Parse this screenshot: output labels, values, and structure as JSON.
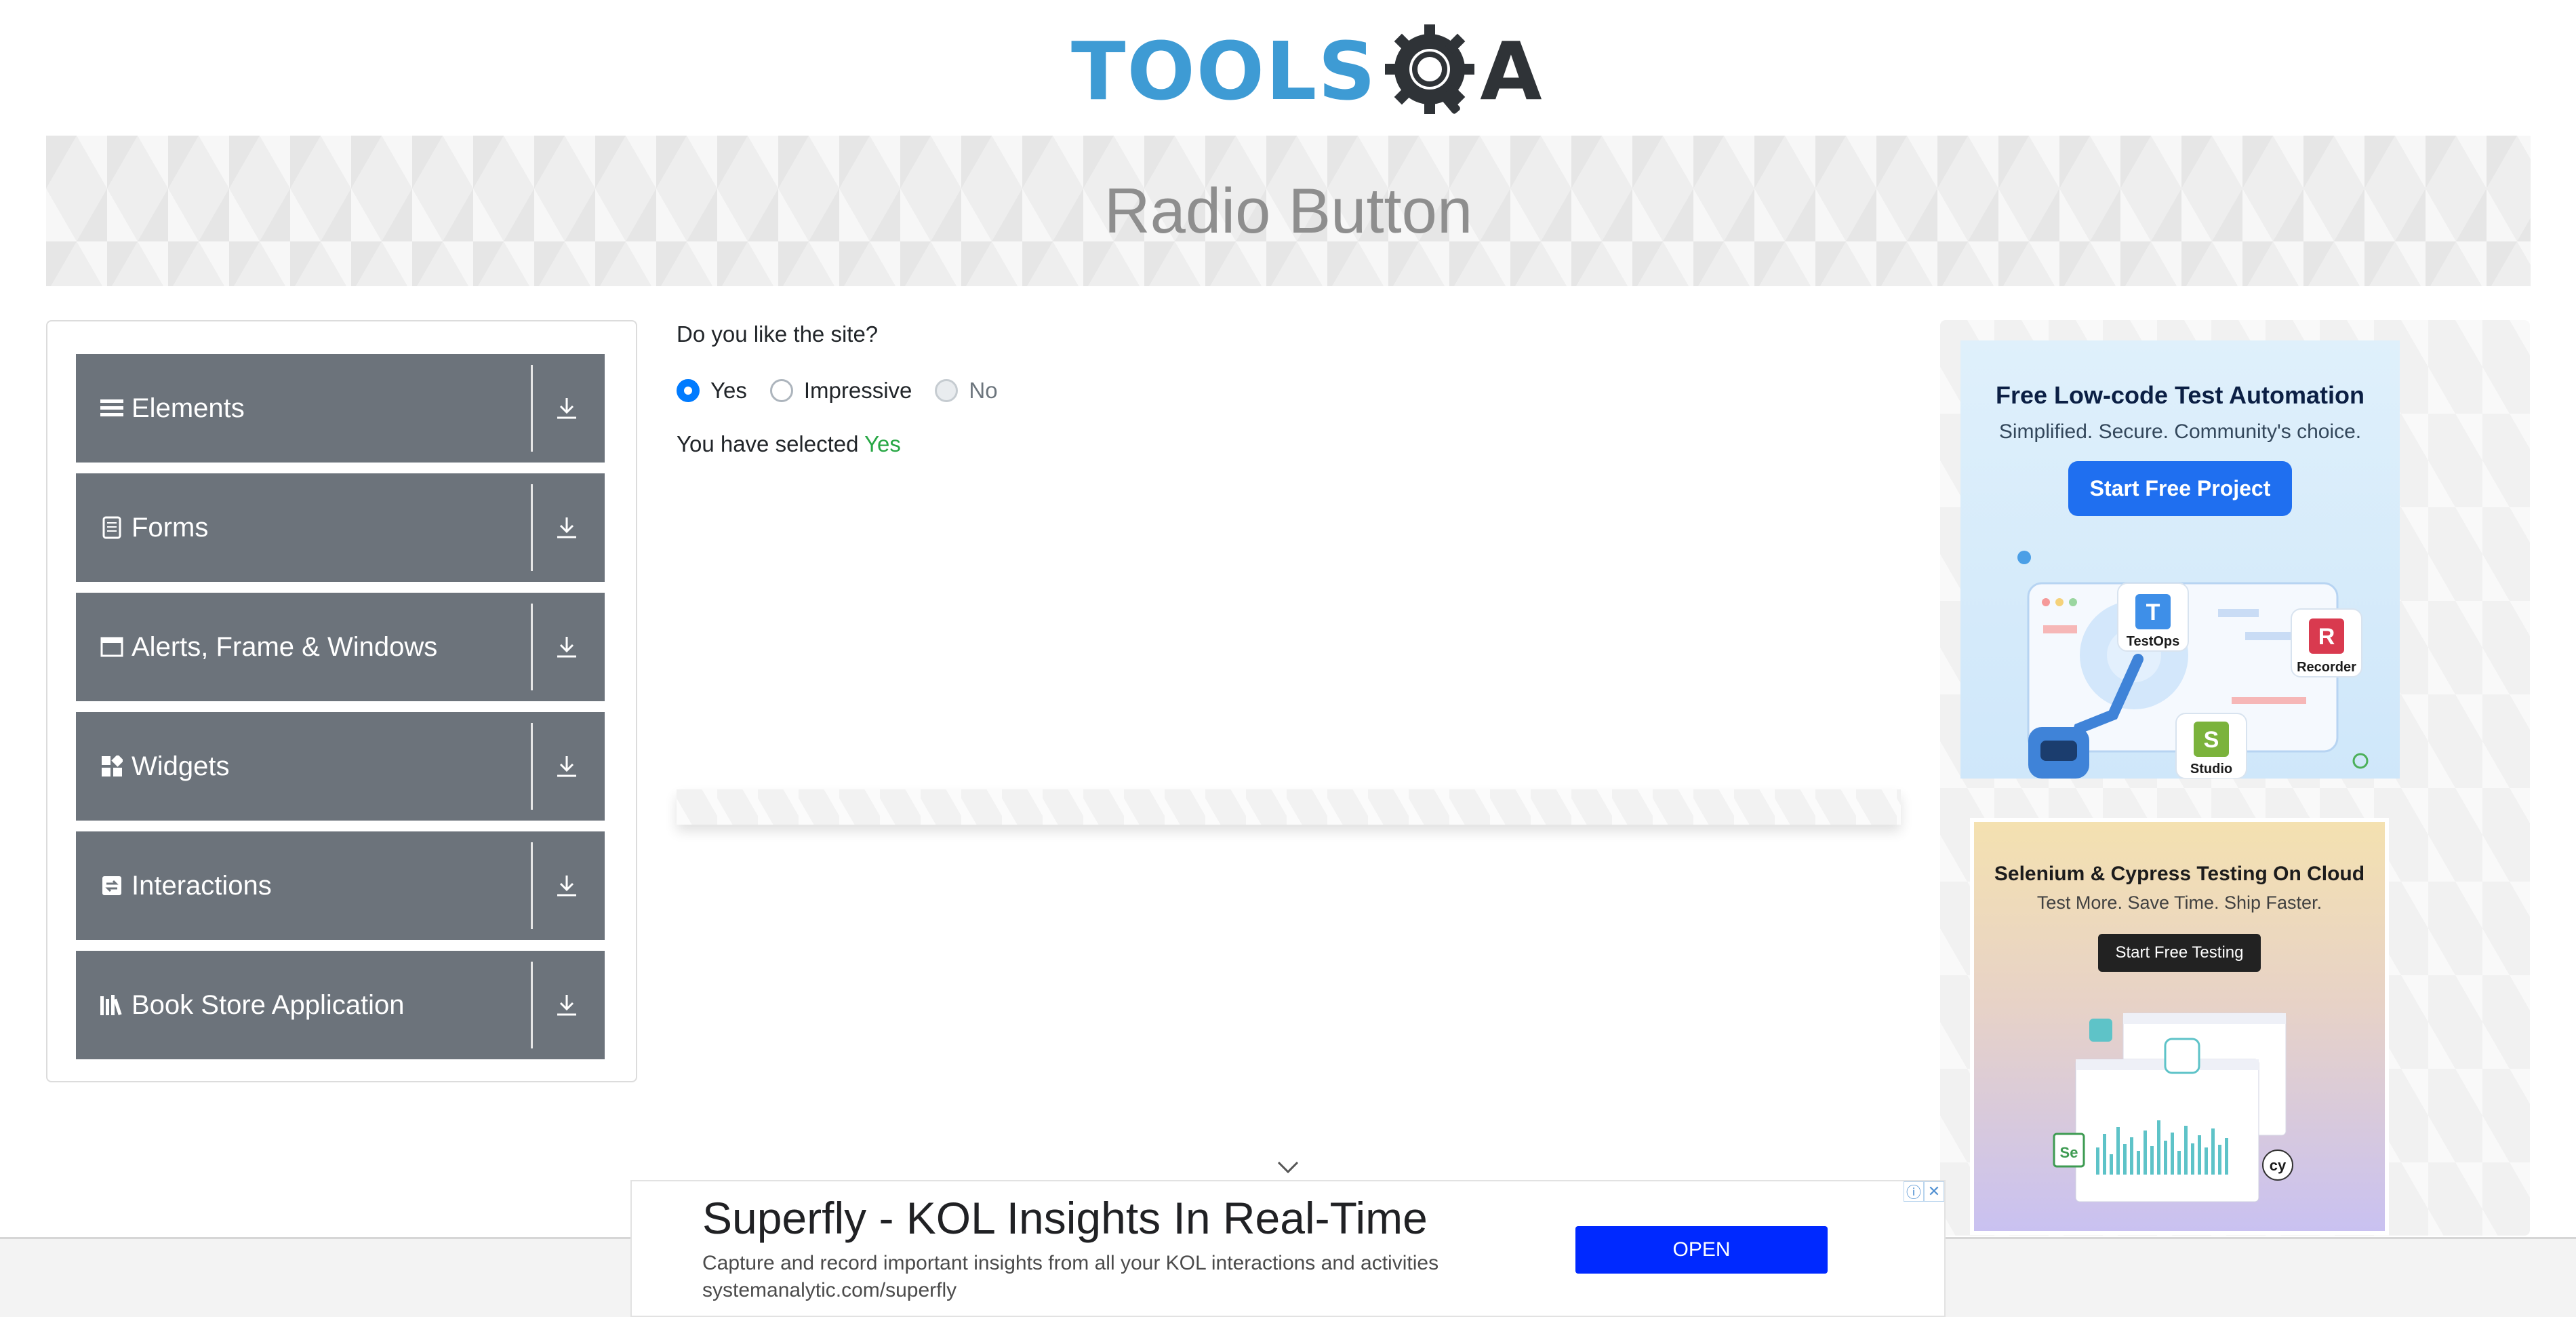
{
  "logo": {
    "part1": "TOOLS",
    "part2": "A"
  },
  "banner": {
    "title": "Radio Button"
  },
  "sidebar": {
    "items": [
      {
        "label": "Elements",
        "icon": "list-icon"
      },
      {
        "label": "Forms",
        "icon": "form-icon"
      },
      {
        "label": "Alerts, Frame & Windows",
        "icon": "window-icon"
      },
      {
        "label": "Widgets",
        "icon": "widgets-icon"
      },
      {
        "label": "Interactions",
        "icon": "interactions-icon"
      },
      {
        "label": "Book Store Application",
        "icon": "books-icon"
      }
    ]
  },
  "main": {
    "question": "Do you like the site?",
    "options": [
      {
        "label": "Yes",
        "checked": true,
        "disabled": false
      },
      {
        "label": "Impressive",
        "checked": false,
        "disabled": false
      },
      {
        "label": "No",
        "checked": false,
        "disabled": true
      }
    ],
    "result_prefix": "You have selected",
    "result_value": "Yes"
  },
  "ads": {
    "katalon": {
      "title": "Free Low-code Test Automation",
      "subtitle": "Simplified. Secure. Community's choice.",
      "button": "Start Free Project",
      "apps": [
        "TestOps",
        "Recorder",
        "Studio"
      ],
      "app_letters": [
        "T",
        "R",
        "S"
      ]
    },
    "lambdatest": {
      "title": "Selenium & Cypress Testing On Cloud",
      "subtitle": "Test More. Save Time. Ship Faster.",
      "button": "Start Free Testing",
      "logo_labels": [
        "Se",
        "cy"
      ]
    },
    "bottom": {
      "headline": "Superfly - KOL Insights In Real-Time",
      "description": "Capture and record important insights from all your KOL interactions and activities",
      "url": "systemanalytic.com/superfly",
      "button": "OPEN"
    }
  },
  "colors": {
    "nav_bg": "#6c737b",
    "radio_checked": "#007bff",
    "success": "#28a745",
    "logo_blue": "#3e9bd4",
    "logo_dark": "#2f3337",
    "open_button": "#0029ff"
  }
}
